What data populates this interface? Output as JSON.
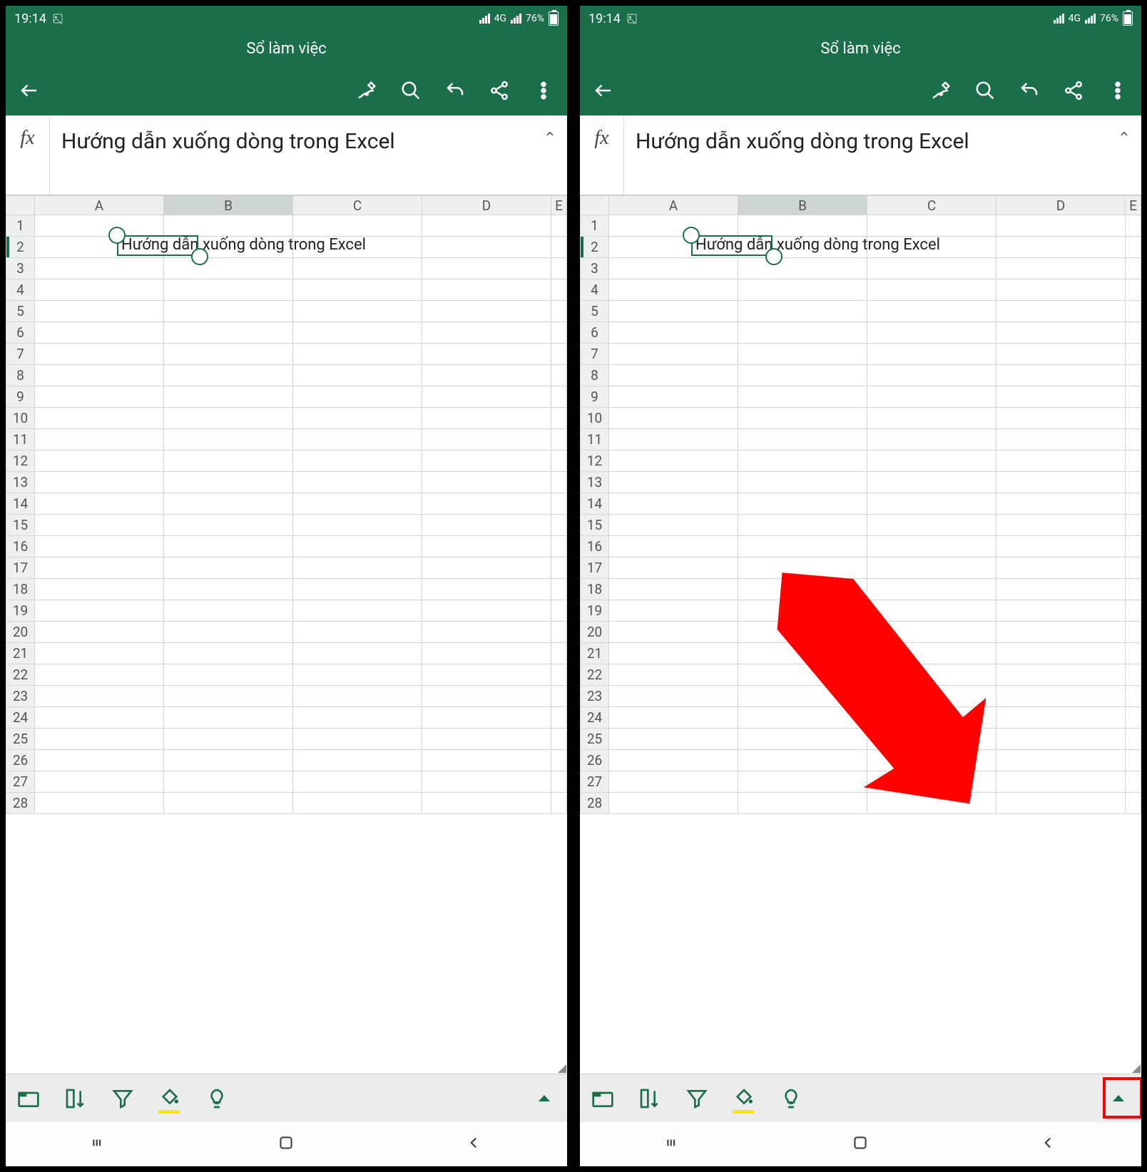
{
  "status": {
    "time": "19:14",
    "network_label": "4G",
    "battery_percent": "76%"
  },
  "header": {
    "title": "Sổ làm việc"
  },
  "formula_bar": {
    "fx_label": "fx",
    "content": "Hướng dẫn xuống dòng trong Excel",
    "collapse_glyph": "⌃"
  },
  "grid": {
    "columns": [
      "A",
      "B",
      "C",
      "D",
      "E"
    ],
    "rows": [
      "1",
      "2",
      "3",
      "4",
      "5",
      "6",
      "7",
      "8",
      "9",
      "10",
      "11",
      "12",
      "13",
      "14",
      "15",
      "16",
      "17",
      "18",
      "19",
      "20",
      "21",
      "22",
      "23",
      "24",
      "25",
      "26",
      "27",
      "28"
    ],
    "selected_cell": "B2",
    "cell_overflow_text": "Hướng dẫn xuống dòng trong Excel"
  },
  "bottom_icons": {
    "sheet": "sheet-icon",
    "sort": "sort-icon",
    "filter": "filter-icon",
    "fill": "fill-color-icon",
    "idea": "lightbulb-icon",
    "expand": "expand-commands-icon"
  },
  "nav": {
    "recents": "recents-icon",
    "home": "home-icon",
    "back": "back-icon"
  },
  "annotation": {
    "arrow_color": "#ff0000"
  }
}
